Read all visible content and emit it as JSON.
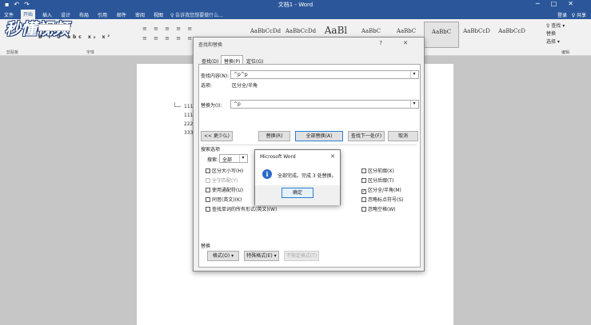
{
  "window": {
    "qat_icons": [
      "save-icon",
      "undo-icon",
      "redo-icon"
    ],
    "title": "文档1 - Word",
    "controls": [
      "─",
      "□",
      "✕"
    ]
  },
  "ribbon": {
    "tabs": [
      "文件",
      "开始",
      "插入",
      "设计",
      "布局",
      "引用",
      "邮件",
      "审阅",
      "视图"
    ],
    "active_tab": "开始",
    "tell_me": "♀ 告诉我您想要做什么...",
    "user": "登录",
    "share": "♀ 共享",
    "logo": "秒懂视频",
    "format_buttons": "B I U abc x₂ x²",
    "paragraph_row1": "≡ ≡ ≡ ≡ ≡",
    "paragraph_row2": "≡ ≡ ≡ ≡ ≡ ≡",
    "styles": [
      "AaBbCcDd",
      "AaBbCcDd",
      "AaBl",
      "AaBbC",
      "AaBbC",
      "AaBbC",
      "AaBbCcD",
      "AaBbCcD",
      "AaBbCcD"
    ],
    "group_labels": {
      "clipboard": "剪贴板",
      "font": "字体",
      "editing": "编辑"
    },
    "editing": {
      "find": "♀ 查找 ▾",
      "replace": "替换",
      "select": "选择 ▾"
    }
  },
  "document": {
    "lines": [
      "111",
      "111",
      "222",
      "333"
    ]
  },
  "find_replace": {
    "title": "查找和替换",
    "controls": "?  ✕",
    "tabs": [
      "查找(D)",
      "替换(P)",
      "定位(G)"
    ],
    "active_tab": "替换(P)",
    "find_label": "查找内容(N):",
    "find_value": "^p^p",
    "options_label": "选项:",
    "options_value": "区分全/半角",
    "replace_label": "替换为(I):",
    "replace_value": "^p",
    "buttons": {
      "less": "<< 更少(L)",
      "replace": "替换(R)",
      "replace_all": "全部替换(A)",
      "find_next": "查找下一处(F)",
      "cancel": "取消"
    },
    "search_options_title": "搜索选项",
    "search_label": "搜索:",
    "search_value": "全部",
    "checkboxes_left": [
      {
        "label": "区分大小写(H)",
        "checked": false,
        "dim": false
      },
      {
        "label": "全字匹配(Y)",
        "checked": false,
        "dim": true
      },
      {
        "label": "使用通配符(U)",
        "checked": false,
        "dim": false
      },
      {
        "label": "同音(英文)(K)",
        "checked": false,
        "dim": false
      },
      {
        "label": "查找单词的所有形式(英文)(W)",
        "checked": false,
        "dim": false
      }
    ],
    "checkboxes_right": [
      {
        "label": "区分前缀(X)",
        "checked": false
      },
      {
        "label": "区分后缀(T)",
        "checked": false
      },
      {
        "label": "区分全/半角(M)",
        "checked": true
      },
      {
        "label": "忽略标点符号(S)",
        "checked": false
      },
      {
        "label": "忽略空格(W)",
        "checked": false
      }
    ],
    "replace_section_title": "替换",
    "format_button": "格式(O) ▾",
    "special_button": "特殊格式(E) ▾",
    "no_format_button": "不限定格式(T)"
  },
  "message_box": {
    "title": "Microsoft Word",
    "close": "✕",
    "icon": "i",
    "text": "全部完成。完成 3 处替换。",
    "ok": "确定"
  }
}
